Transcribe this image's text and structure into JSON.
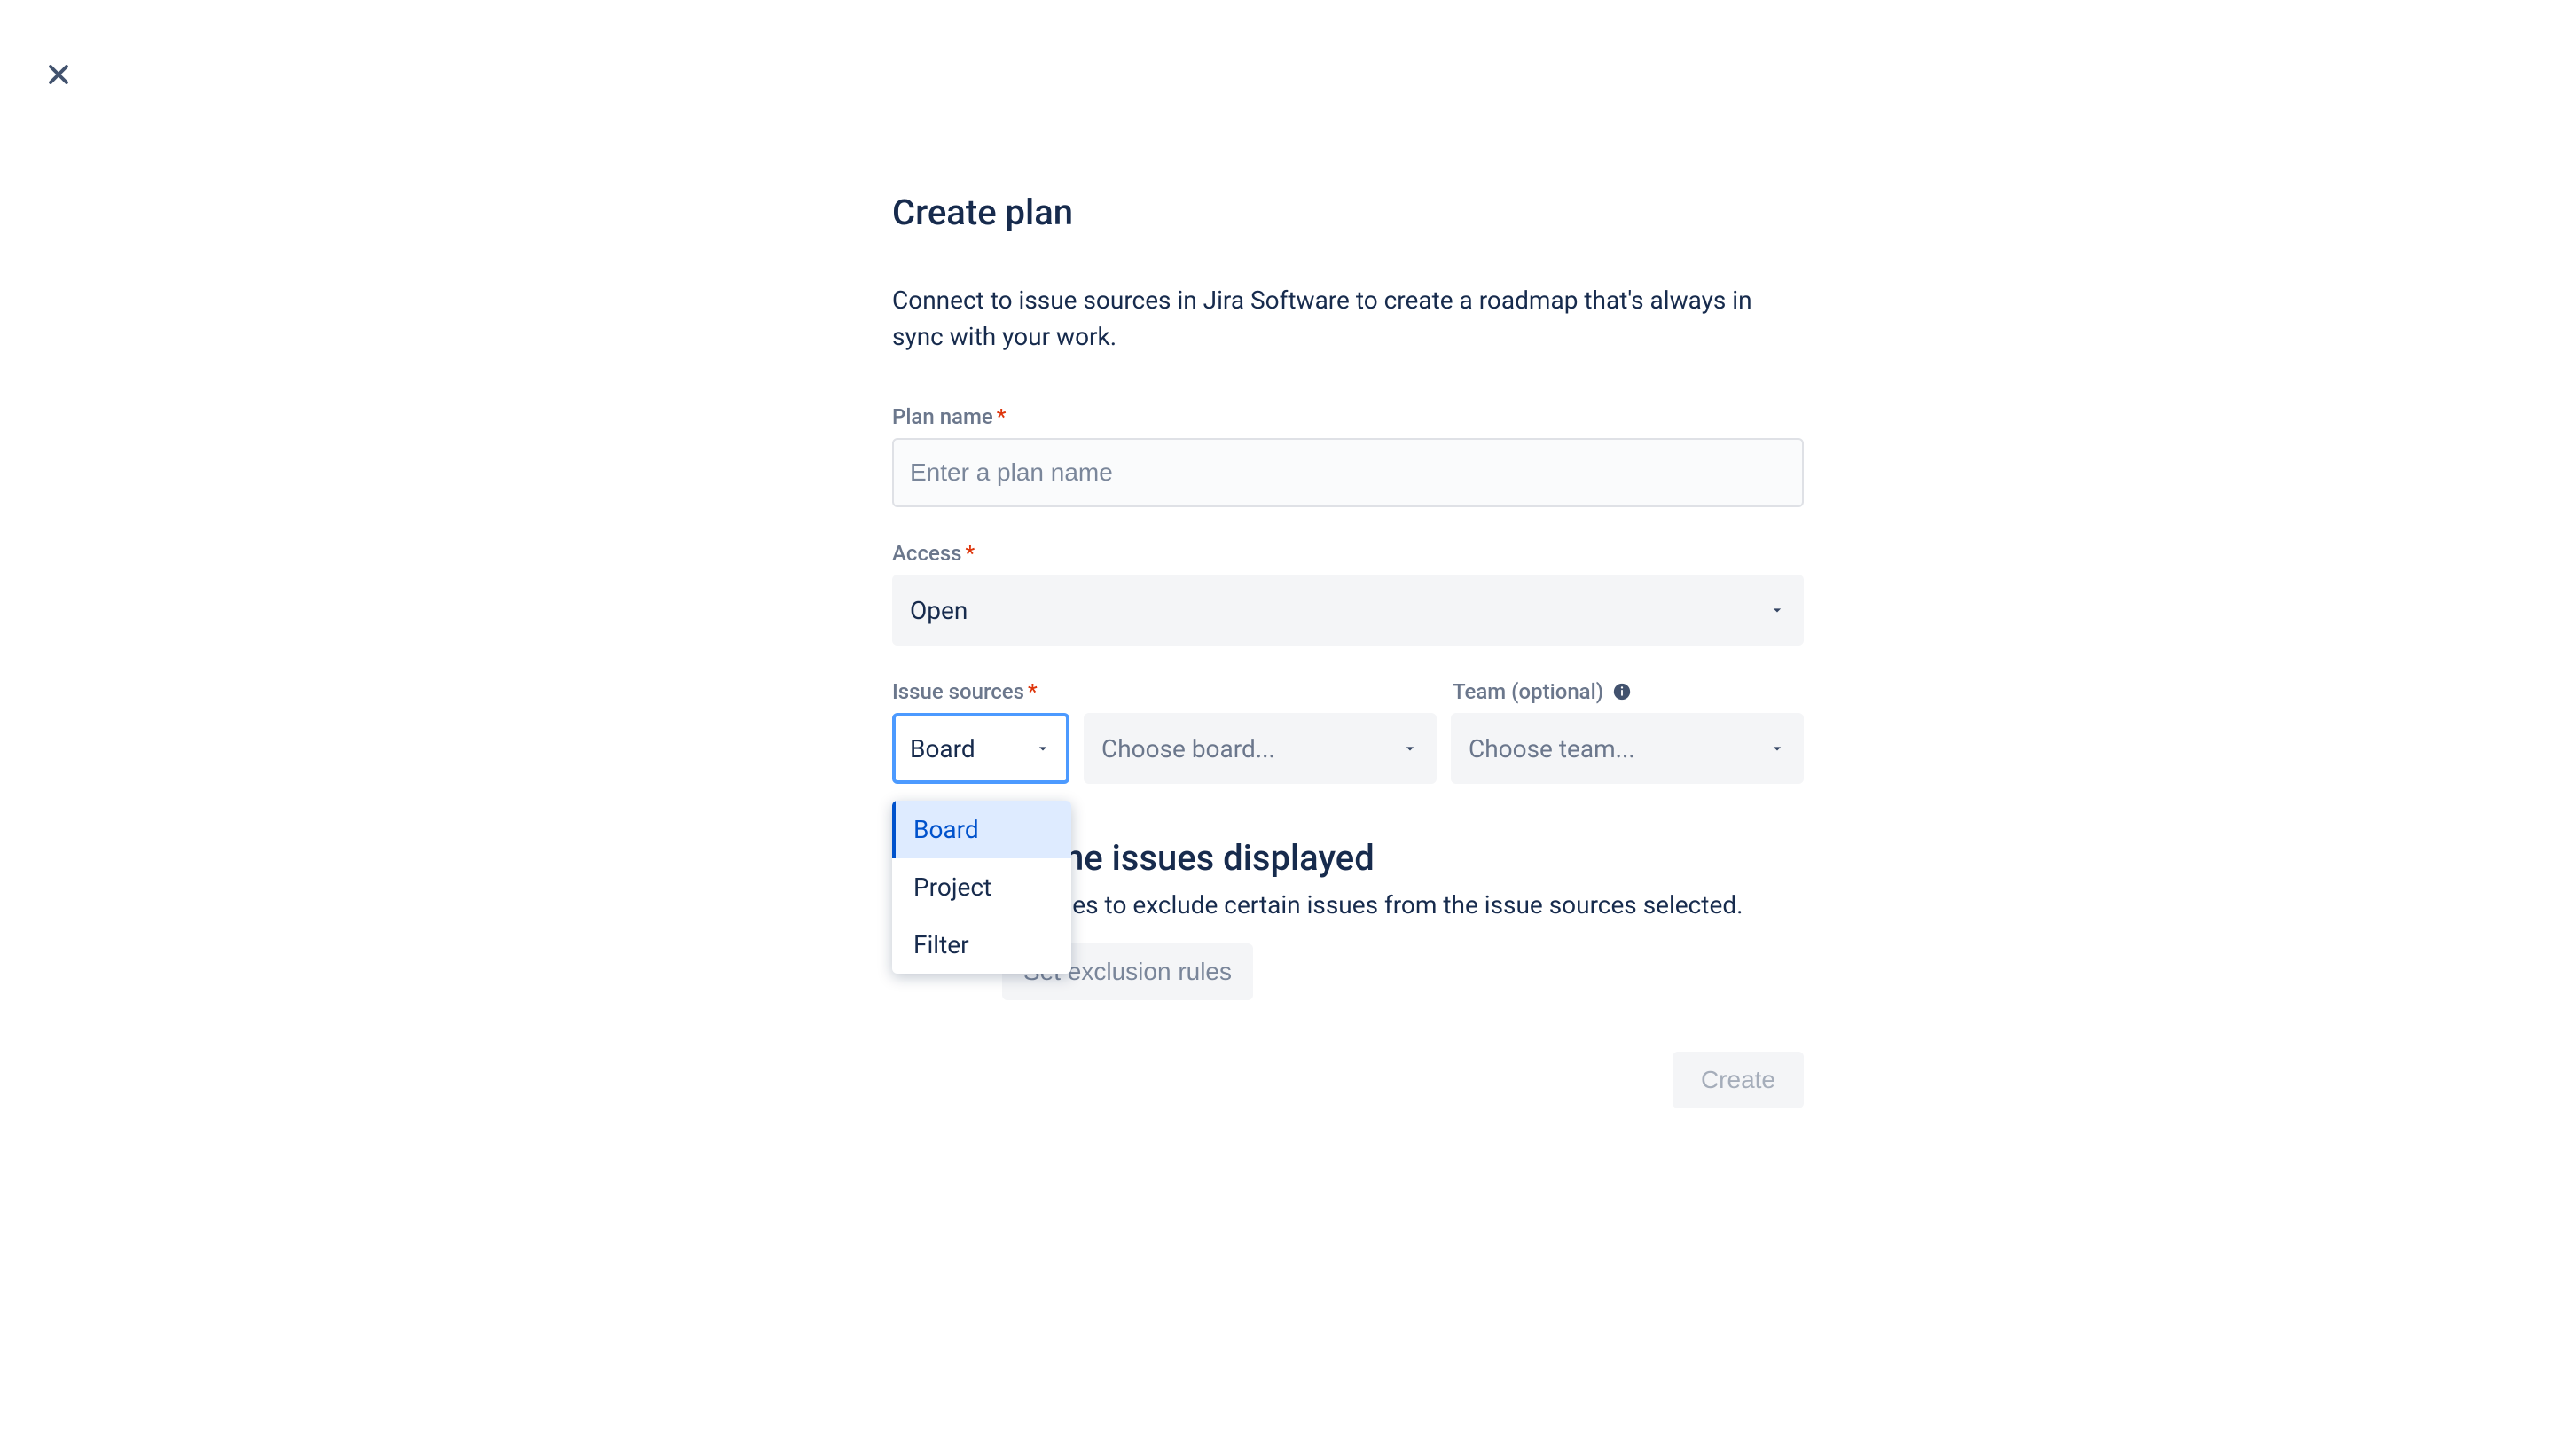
{
  "close_label": "Close",
  "title": "Create plan",
  "description": "Connect to issue sources in Jira Software to create a roadmap that's always in sync with your work.",
  "fields": {
    "plan_name": {
      "label": "Plan name",
      "placeholder": "Enter a plan name",
      "required": true
    },
    "access": {
      "label": "Access",
      "value": "Open",
      "required": true
    },
    "issue_sources": {
      "label": "Issue sources",
      "required": true,
      "type_value": "Board",
      "type_options": [
        "Board",
        "Project",
        "Filter"
      ],
      "value_placeholder": "Choose board..."
    },
    "team": {
      "label": "Team (optional)",
      "placeholder": "Choose team..."
    }
  },
  "refine": {
    "title": "Refine issues displayed",
    "description": "Set rules to exclude certain issues from the issue sources selected.",
    "button_label": "Set exclusion rules"
  },
  "footer": {
    "create_label": "Create"
  }
}
